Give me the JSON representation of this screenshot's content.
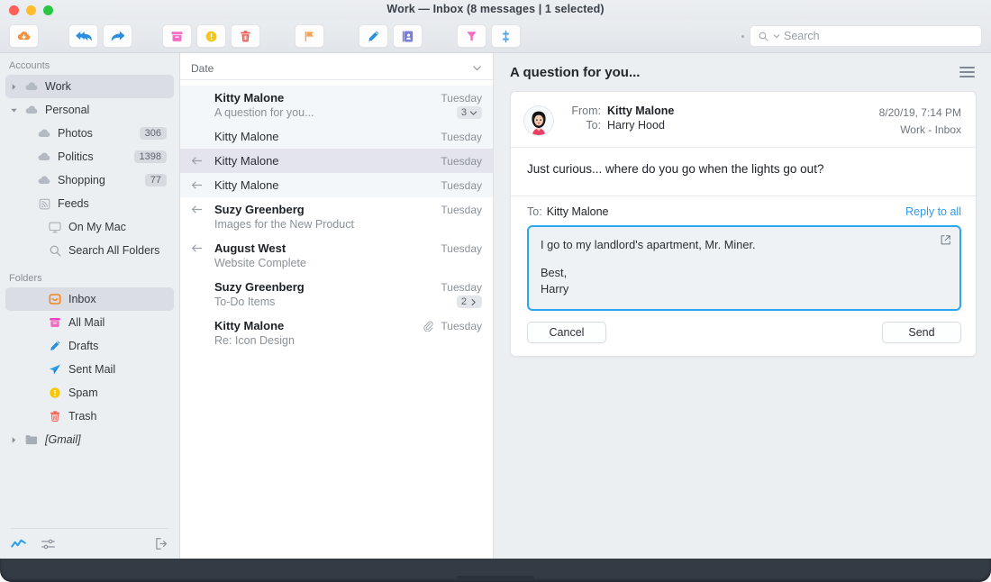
{
  "window": {
    "title": "Work — Inbox (8 messages | 1 selected)",
    "traffic": {
      "close": "close-button",
      "minimize": "minimize-button",
      "zoom": "zoom-button"
    }
  },
  "toolbar": {
    "buttons": [
      {
        "name": "get-mail-button",
        "icon": "cloud-download-icon",
        "color": "#f5923e"
      },
      {
        "name": "reply-all-button",
        "icon": "reply-all-icon",
        "color": "#2a8fe0"
      },
      {
        "name": "forward-button",
        "icon": "forward-arrow-icon",
        "color": "#2a8fe0"
      },
      {
        "name": "archive-button",
        "icon": "archive-box-icon",
        "color": "#f06ec4"
      },
      {
        "name": "spam-button",
        "icon": "spam-alert-icon",
        "color": "#f5c518"
      },
      {
        "name": "delete-button",
        "icon": "trash-icon",
        "color": "#f0594f"
      },
      {
        "name": "flag-button",
        "icon": "flag-icon",
        "color": "#f5a350"
      },
      {
        "name": "compose-button",
        "icon": "pencil-icon",
        "color": "#2a8fe0"
      },
      {
        "name": "contacts-button",
        "icon": "contact-card-icon",
        "color": "#7a7fd6"
      },
      {
        "name": "filter-button",
        "icon": "funnel-icon",
        "color": "#f06ec4"
      },
      {
        "name": "sort-button",
        "icon": "sliders-icon",
        "color": "#4aa8e8"
      }
    ],
    "search": {
      "placeholder": "Search",
      "icon": "search-icon"
    }
  },
  "sidebar": {
    "sections": [
      {
        "title": "Accounts",
        "items": [
          {
            "label": "Work",
            "icon": "cloud-icon",
            "twisty": "right",
            "indent": 0,
            "selected": true,
            "badge": ""
          },
          {
            "label": "Personal",
            "icon": "cloud-icon",
            "twisty": "down",
            "indent": 0,
            "selected": false,
            "badge": ""
          },
          {
            "label": "Photos",
            "icon": "cloud-icon",
            "twisty": "",
            "indent": 1,
            "selected": false,
            "badge": "306"
          },
          {
            "label": "Politics",
            "icon": "cloud-icon",
            "twisty": "",
            "indent": 1,
            "selected": false,
            "badge": "1398"
          },
          {
            "label": "Shopping",
            "icon": "cloud-icon",
            "twisty": "",
            "indent": 1,
            "selected": false,
            "badge": "77"
          },
          {
            "label": "Feeds",
            "icon": "rss-icon",
            "twisty": "",
            "indent": 1,
            "selected": false,
            "badge": ""
          },
          {
            "label": "On My Mac",
            "icon": "monitor-icon",
            "twisty": "",
            "indent": 2,
            "selected": false,
            "badge": ""
          },
          {
            "label": "Search All Folders",
            "icon": "search-icon",
            "twisty": "",
            "indent": 2,
            "selected": false,
            "badge": ""
          }
        ]
      },
      {
        "title": "Folders",
        "items": [
          {
            "label": "Inbox",
            "icon": "inbox-icon",
            "twisty": "",
            "indent": 2,
            "selected": true,
            "badge": ""
          },
          {
            "label": "All Mail",
            "icon": "archive-box-icon",
            "twisty": "",
            "indent": 2,
            "selected": false,
            "badge": ""
          },
          {
            "label": "Drafts",
            "icon": "pencil-icon",
            "twisty": "",
            "indent": 2,
            "selected": false,
            "badge": ""
          },
          {
            "label": "Sent Mail",
            "icon": "paper-plane-icon",
            "twisty": "",
            "indent": 2,
            "selected": false,
            "badge": ""
          },
          {
            "label": "Spam",
            "icon": "spam-alert-icon",
            "twisty": "",
            "indent": 2,
            "selected": false,
            "badge": ""
          },
          {
            "label": "Trash",
            "icon": "trash-icon",
            "twisty": "",
            "indent": 2,
            "selected": false,
            "badge": ""
          },
          {
            "label": "[Gmail]",
            "icon": "folder-icon",
            "twisty": "right",
            "indent": 0,
            "selected": false,
            "badge": "",
            "italic": true
          }
        ]
      }
    ],
    "footer": [
      {
        "name": "activity-icon",
        "color": "#2a9ff0"
      },
      {
        "name": "settings-sliders-icon",
        "color": "#8d949b"
      },
      {
        "name": "logout-icon",
        "color": "#8d949b"
      }
    ]
  },
  "message_list": {
    "sort_column": "Date",
    "sort_icon": "chevron-down-icon",
    "rows": [
      {
        "sender": "Kitty Malone",
        "subject": "A question for you...",
        "date": "Tuesday",
        "count": "3",
        "count_chevron": "down",
        "arrow": false,
        "bold": true,
        "bg": "bg-a",
        "attachment": false
      },
      {
        "sender": "Kitty Malone",
        "subject": "",
        "date": "Tuesday",
        "count": "",
        "count_chevron": "",
        "arrow": false,
        "bold": false,
        "bg": "bg-a",
        "attachment": false,
        "child": true
      },
      {
        "sender": "Kitty Malone",
        "subject": "",
        "date": "Tuesday",
        "count": "",
        "count_chevron": "",
        "arrow": true,
        "bold": false,
        "bg": "bg-sel",
        "attachment": false,
        "child": true
      },
      {
        "sender": "Kitty Malone",
        "subject": "",
        "date": "Tuesday",
        "count": "",
        "count_chevron": "",
        "arrow": true,
        "bold": false,
        "bg": "bg-a",
        "attachment": false,
        "child": true
      },
      {
        "sender": "Suzy Greenberg",
        "subject": "Images for the New Product",
        "date": "Tuesday",
        "count": "",
        "count_chevron": "",
        "arrow": true,
        "bold": true,
        "bg": "",
        "attachment": false
      },
      {
        "sender": "August West",
        "subject": "Website Complete",
        "date": "Tuesday",
        "count": "",
        "count_chevron": "",
        "arrow": true,
        "bold": true,
        "bg": "",
        "attachment": false
      },
      {
        "sender": "Suzy Greenberg",
        "subject": "To-Do Items",
        "date": "Tuesday",
        "count": "2",
        "count_chevron": "right",
        "arrow": false,
        "bold": true,
        "bg": "",
        "attachment": false
      },
      {
        "sender": "Kitty Malone",
        "subject": "Re: Icon Design",
        "date": "Tuesday",
        "count": "",
        "count_chevron": "",
        "arrow": false,
        "bold": true,
        "bg": "",
        "attachment": true
      }
    ]
  },
  "reader": {
    "title": "A question for you...",
    "menu_icon": "hamburger-menu-icon",
    "message": {
      "from_label": "From:",
      "from_value": "Kitty Malone",
      "to_label": "To:",
      "to_value": "Harry Hood",
      "timestamp": "8/20/19, 7:14 PM",
      "mailbox": "Work - Inbox",
      "body": "Just curious... where do you go when the lights go out?",
      "avatar_name": "avatar"
    },
    "reply": {
      "to_label": "To:",
      "to_value": "Kitty Malone",
      "reply_all_label": "Reply to all",
      "draft_line1": "I go to my landlord's apartment, Mr. Miner.",
      "draft_line2": "Best,",
      "draft_line3": "Harry",
      "popout_icon": "popout-icon",
      "cancel_label": "Cancel",
      "send_label": "Send",
      "focus_color": "#2ca6f0"
    }
  }
}
